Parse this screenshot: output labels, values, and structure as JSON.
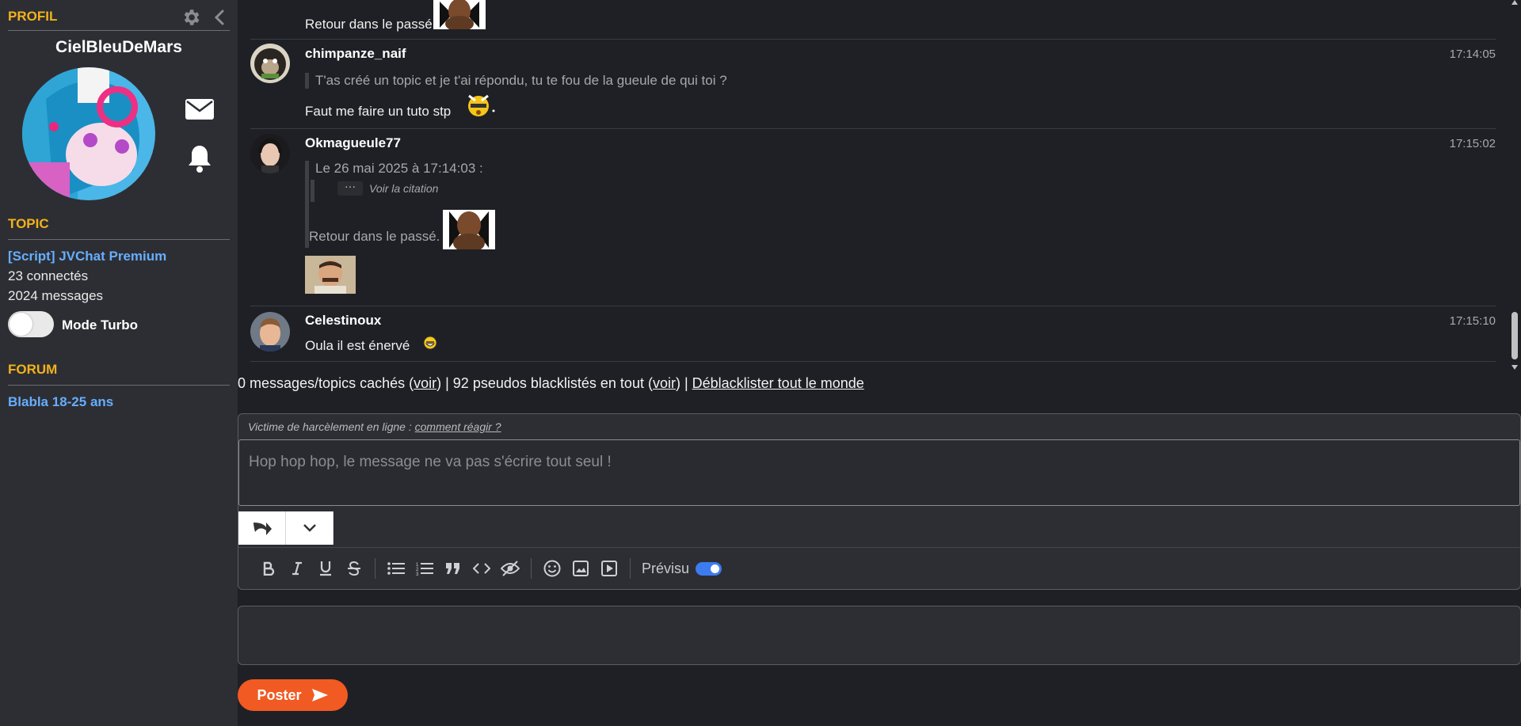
{
  "sidebar": {
    "profile_title": "PROFIL",
    "username": "CielBleuDeMars",
    "topic_title": "TOPIC",
    "topic_name": "[Script] JVChat Premium",
    "connected": "23 connectés",
    "messages": "2024 messages",
    "turbo_label": "Mode Turbo",
    "turbo_on": false,
    "forum_title": "FORUM",
    "forum_name": "Blabla 18-25 ans"
  },
  "messages": [
    {
      "text": "Retour dans le passé."
    },
    {
      "author": "chimpanze_naif",
      "time": "17:14:05",
      "quote": "T'as créé un topic et je t'ai répondu, tu te fou de la gueule de qui toi ?",
      "text": "Faut me faire un tuto stp"
    },
    {
      "author": "Okmagueule77",
      "time": "17:15:02",
      "quote_header": "Le 26 mai 2025 à 17:14:03 :",
      "quote_more": "Voir la citation",
      "quote_text": "Retour dans le passé."
    },
    {
      "author": "Celestinoux",
      "time": "17:15:10",
      "text": "Oula il est énervé"
    }
  ],
  "blacklist": {
    "part1": "0 messages/topics cachés (",
    "voir1": "voir",
    "part2": ") | 92 pseudos blacklistés en tout (",
    "voir2": "voir",
    "part3": ") | ",
    "deblacklist": "Déblacklister tout le monde"
  },
  "editor": {
    "harass_text": "Victime de harcèlement en ligne : ",
    "harass_link": "comment réagir ?",
    "placeholder": "Hop hop hop, le message ne va pas s'écrire tout seul !",
    "preview_label": "Prévisu",
    "preview_on": true
  },
  "post_label": "Poster",
  "colors": {
    "accent": "#f2b21d",
    "link": "#66aeff",
    "post": "#f15a22",
    "toggle": "#3d7cf0"
  }
}
